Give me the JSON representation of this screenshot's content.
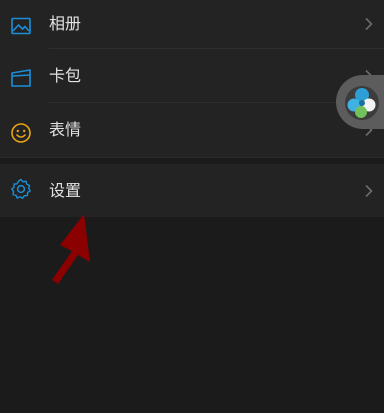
{
  "menu": {
    "items": [
      {
        "label": "相册",
        "icon": "image-icon",
        "icon_color": "#1a8fd9"
      },
      {
        "label": "卡包",
        "icon": "card-wallet-icon",
        "icon_color": "#1a8fd9"
      },
      {
        "label": "表情",
        "icon": "smiley-icon",
        "icon_color": "#e8a317"
      }
    ],
    "settings": {
      "label": "设置",
      "icon": "gear-icon",
      "icon_color": "#1a8fd9"
    }
  },
  "colors": {
    "background": "#1b1b1b",
    "row_background": "#232323",
    "text": "#e2e2e2",
    "chevron": "#6c6c6c",
    "annotation_arrow": "#8b0000"
  }
}
